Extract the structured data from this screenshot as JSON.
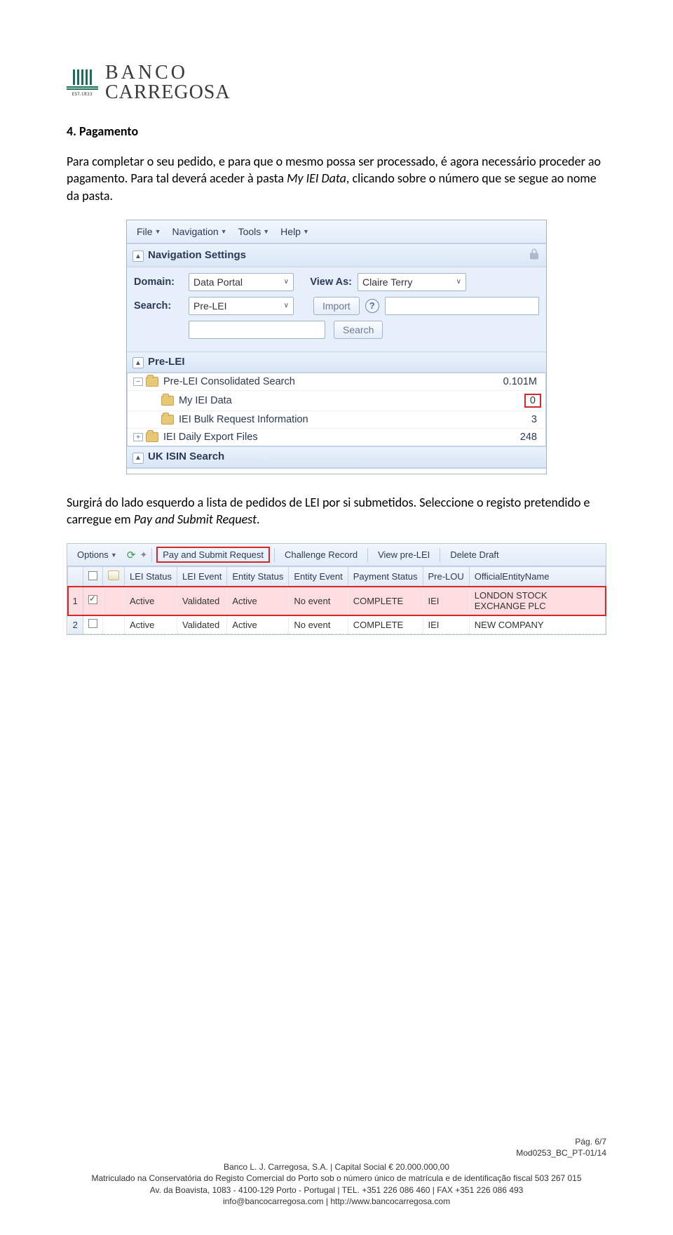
{
  "logo": {
    "line1": "BANCO",
    "line2": "CARREGOSA",
    "est": "EST.1833"
  },
  "section_title": "4. Pagamento",
  "para1_a": "Para completar o seu pedido, e para que o mesmo possa ser processado, é agora necessário proceder ao pagamento. Para tal deverá aceder à pasta ",
  "para1_i": "My IEI Data",
  "para1_b": ", clicando sobre o número que se segue ao nome da pasta.",
  "para2_a": "Surgirá do lado esquerdo a lista de pedidos de LEI por si submetidos. Seleccione o registo pretendido e carregue em ",
  "para2_i": "Pay and Submit Request",
  "para2_b": ".",
  "shot1": {
    "menus": [
      "File",
      "Navigation",
      "Tools",
      "Help"
    ],
    "panel_nav": "Navigation Settings",
    "labels": {
      "domain": "Domain:",
      "viewas": "View As:",
      "search": "Search:"
    },
    "domain_value": "Data Portal",
    "viewas_value": "Claire Terry",
    "search_value": "Pre-LEI",
    "import_btn": "Import",
    "search_btn": "Search",
    "panel_prelei": "Pre-LEI",
    "tree": [
      {
        "label": "Pre-LEI Consolidated Search",
        "count": "0.101M",
        "expander": "-",
        "indent": 0
      },
      {
        "label": "My IEI Data",
        "count": "0",
        "expander": "",
        "indent": 1,
        "highlight": true
      },
      {
        "label": "IEI Bulk Request Information",
        "count": "3",
        "expander": "",
        "indent": 1
      },
      {
        "label": "IEI Daily Export Files",
        "count": "248",
        "expander": "+",
        "indent": 0
      }
    ],
    "panel_uk": "UK ISIN Search"
  },
  "shot2": {
    "toolbar": {
      "options": "Options",
      "pay": "Pay and Submit Request",
      "challenge": "Challenge Record",
      "view": "View pre-LEI",
      "delete": "Delete Draft"
    },
    "headers": [
      "LEI Status",
      "LEI Event",
      "Entity Status",
      "Entity Event",
      "Payment Status",
      "Pre-LOU",
      "OfficialEntityName"
    ],
    "rows": [
      {
        "n": "1",
        "checked": true,
        "cells": [
          "Active",
          "Validated",
          "Active",
          "No event",
          "COMPLETE",
          "IEI",
          "LONDON STOCK EXCHANGE PLC"
        ],
        "selected": true
      },
      {
        "n": "2",
        "checked": false,
        "cells": [
          "Active",
          "Validated",
          "Active",
          "No event",
          "COMPLETE",
          "IEI",
          "NEW COMPANY"
        ],
        "selected": false
      }
    ]
  },
  "footer": {
    "page": "Pág. 6/7",
    "mod": "Mod0253_BC_PT-01/14",
    "l1": "Banco L. J. Carregosa, S.A. | Capital Social € 20.000.000,00",
    "l2": "Matriculado na Conservatória do Registo Comercial do Porto sob o número único de matrícula e de identificação fiscal 503 267 015",
    "l3": "Av. da Boavista, 1083 - 4100-129 Porto - Portugal | TEL. +351 226 086 460 | FAX +351 226 086 493",
    "l4": "info@bancocarregosa.com | http://www.bancocarregosa.com"
  }
}
